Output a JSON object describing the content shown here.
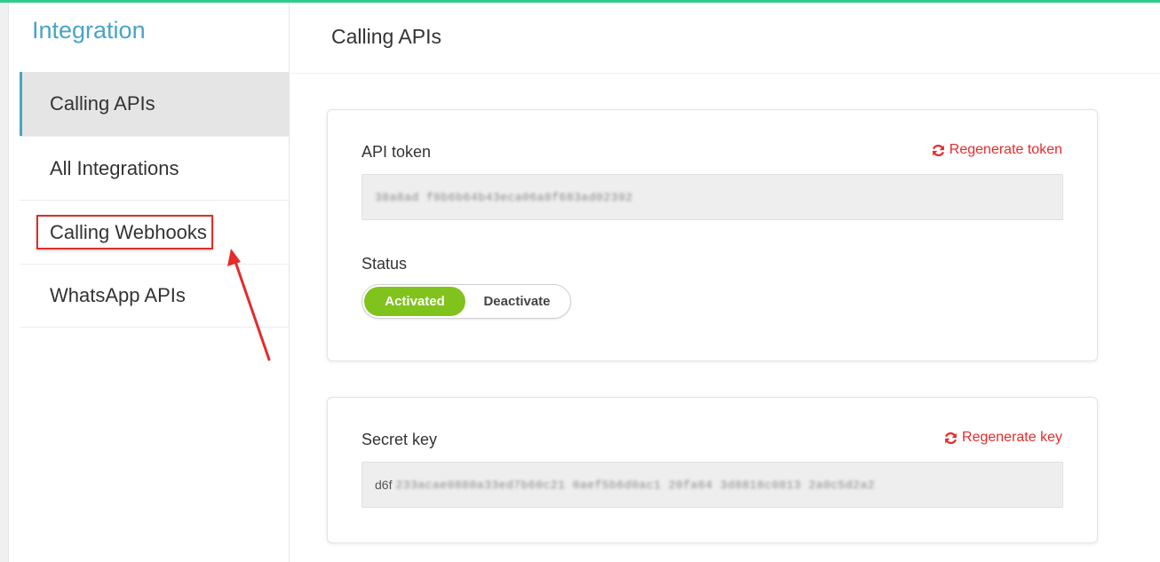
{
  "sidebar": {
    "title": "Integration",
    "items": [
      {
        "label": "Calling APIs"
      },
      {
        "label": "All Integrations"
      },
      {
        "label": "Calling Webhooks"
      },
      {
        "label": "WhatsApp APIs"
      }
    ]
  },
  "header": {
    "title": "Calling APIs"
  },
  "api_card": {
    "token_label": "API token",
    "regenerate_label": "Regenerate token",
    "token_value": "38a8ad f0b6b64b43eca06a8f683ad02392",
    "status_label": "Status",
    "toggle_on": "Activated",
    "toggle_off": "Deactivate"
  },
  "secret_card": {
    "label": "Secret key",
    "regenerate_label": "Regenerate key",
    "value_prefix": "d6f",
    "value_blurred": "233acae0880a33ed7b60c21 0aef5b6d0ac1 20fa64 3d8818c0813 2a0c5d2a2"
  },
  "colors": {
    "accent_top": "#2ecc8a",
    "sidebar_title": "#4aa3c8",
    "regen_red": "#e52b2b",
    "toggle_green": "#7fc31c",
    "annotation_red": "#d9302a"
  }
}
